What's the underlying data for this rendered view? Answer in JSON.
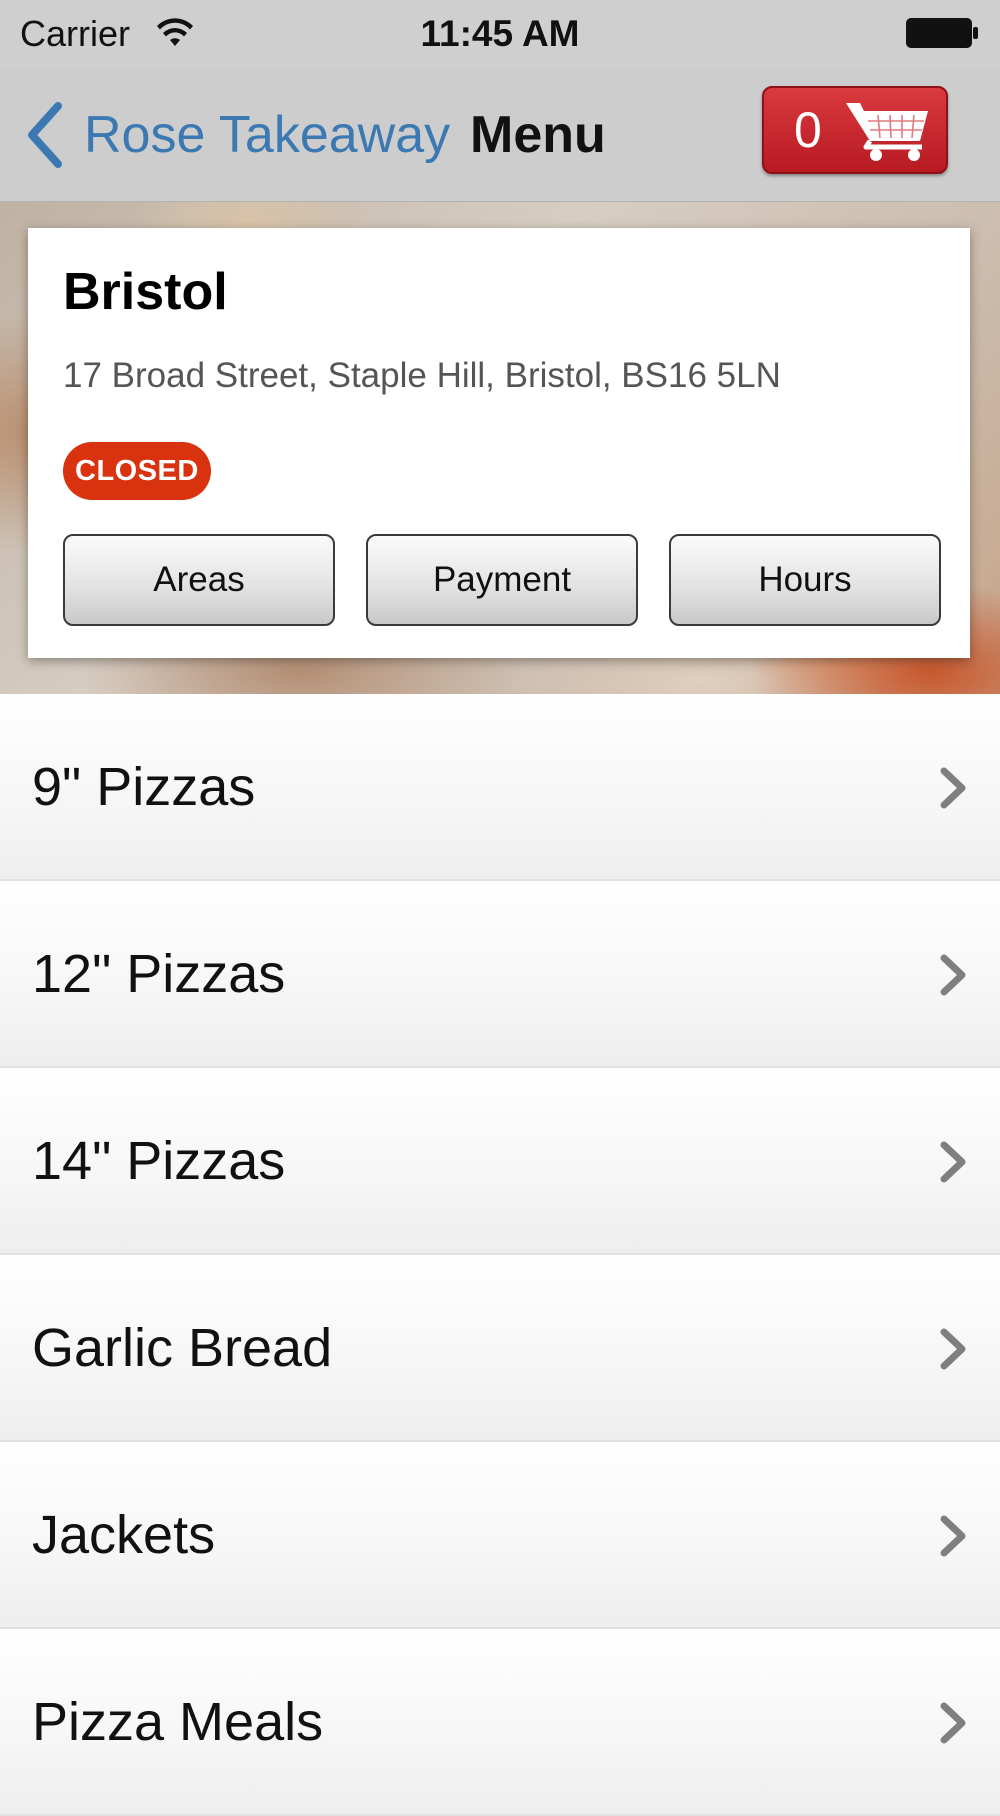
{
  "status_bar": {
    "carrier": "Carrier",
    "time": "11:45 AM",
    "wifi_icon": "wifi-icon",
    "battery_icon": "battery-icon"
  },
  "nav": {
    "back_label": "Rose Takeaway",
    "back_icon": "chevron-left-icon",
    "title": "Menu",
    "cart_count": "0",
    "cart_icon": "shopping-cart-icon"
  },
  "restaurant": {
    "name": "Bristol",
    "address": "17 Broad Street, Staple Hill, Bristol, BS16 5LN",
    "status": "CLOSED",
    "buttons": {
      "areas": "Areas",
      "payment": "Payment",
      "hours": "Hours"
    }
  },
  "menu": {
    "items": [
      {
        "label": "9\" Pizzas"
      },
      {
        "label": "12\" Pizzas"
      },
      {
        "label": "14\" Pizzas"
      },
      {
        "label": "Garlic Bread"
      },
      {
        "label": "Jackets"
      },
      {
        "label": "Pizza Meals"
      }
    ],
    "item_icon": "chevron-right-icon"
  },
  "colors": {
    "accent_blue": "#3c79b2",
    "cart_red": "#c8242c",
    "closed_badge": "#d9320f",
    "nav_bg": "#cdcdcd"
  }
}
